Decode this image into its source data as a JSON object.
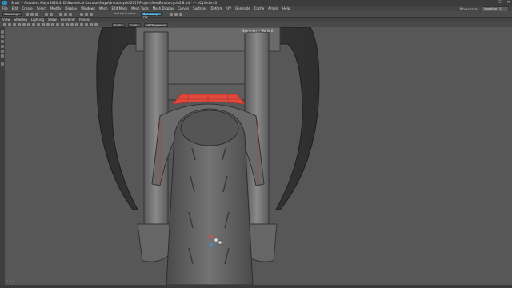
{
  "window": {
    "title": "Scott* - Autodesk Maya 2020.4: D:\\Numerical Calculus\\Maya\\Bmotorcycle\\2017\\Project\\files\\Bmotorcycle2.8.mb* --- pCylinder40",
    "controls": [
      "—",
      "☐",
      "✕"
    ]
  },
  "menus": [
    "File",
    "Edit",
    "Create",
    "Select",
    "Modify",
    "Display",
    "Windows",
    "Mesh",
    "Edit Mesh",
    "Mesh Tools",
    "Mesh Display",
    "Curves",
    "Surfaces",
    "Deform",
    "UV",
    "Generate",
    "Cache",
    "Arnold",
    "Help"
  ],
  "workspace": {
    "label": "Workspace :",
    "value": "Modeling - S"
  },
  "statusline": {
    "mode": "Modeling",
    "live_surface": "No Live Surface",
    "symmetry": "Symmetry: Off"
  },
  "viewport_menus": [
    "View",
    "Shading",
    "Lighting",
    "Show",
    "Renderer",
    "Panels"
  ],
  "viewport_toolbar": {
    "gamma": "0.00",
    "exposure": "1.00",
    "colorspace": "sRGB gamma"
  },
  "viewport_label": "Symmetry: World X",
  "axis": {
    "x": "x",
    "y": "y",
    "z": "z"
  },
  "colors": {
    "accent": "#2a8fbd",
    "selection_red": "#e04a3c",
    "viewport_bg": "#575757"
  },
  "icons": [
    "maya-logo-icon",
    "move-tool-icon",
    "rotate-tool-icon",
    "scale-tool-icon",
    "select-tool-icon",
    "lasso-tool-icon",
    "paint-select-icon",
    "manipulator-icon",
    "camera-icon",
    "grid-icon",
    "wireframe-icon",
    "smooth-shade-icon",
    "textured-icon",
    "lighting-icon",
    "shadows-icon",
    "xray-icon",
    "isolate-icon"
  ]
}
